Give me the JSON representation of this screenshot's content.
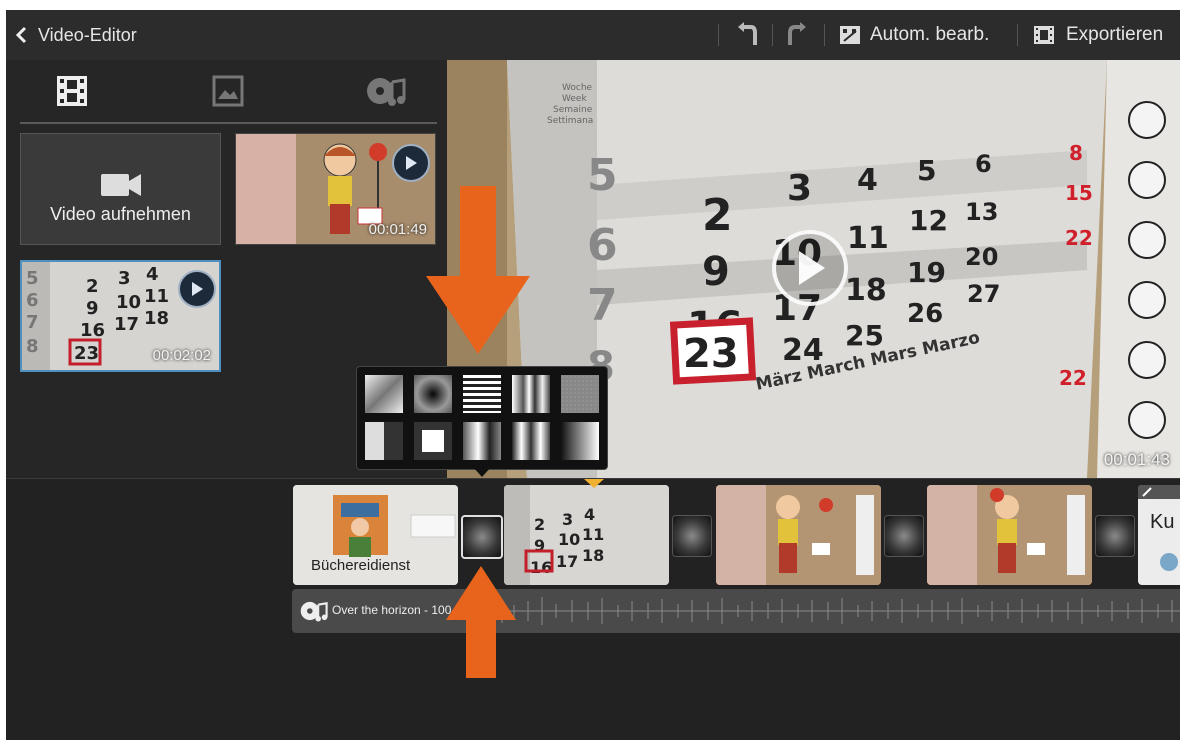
{
  "topbar": {
    "back_label": "Video-Editor",
    "auto_edit_label": "Autom. bearb.",
    "export_label": "Exportieren"
  },
  "left_panel": {
    "tabs": [
      {
        "icon": "film-icon",
        "active": true
      },
      {
        "icon": "image-icon",
        "active": false
      },
      {
        "icon": "music-icon",
        "active": false
      }
    ],
    "record_button_label": "Video aufnehmen",
    "media_items": [
      {
        "duration": "00:01:49"
      },
      {
        "duration": "00:02:02"
      }
    ]
  },
  "preview": {
    "duration": "00:01:43",
    "calendar_text": {
      "weekday_labels": [
        "Woche",
        "Week",
        "Semaine",
        "Settimana"
      ],
      "months": "März  March  Mars  Marzo"
    }
  },
  "timeline": {
    "clips": [
      {
        "caption": "Büchereidienst"
      },
      {
        "caption": ""
      },
      {
        "caption": ""
      },
      {
        "caption": ""
      },
      {
        "caption": "Ku"
      }
    ],
    "audio_track_label": "Over the horizon - 100"
  },
  "colors": {
    "accent_orange": "#e8641c",
    "bg_dark": "#1c1c1c",
    "topbar": "#2c2c2c"
  }
}
